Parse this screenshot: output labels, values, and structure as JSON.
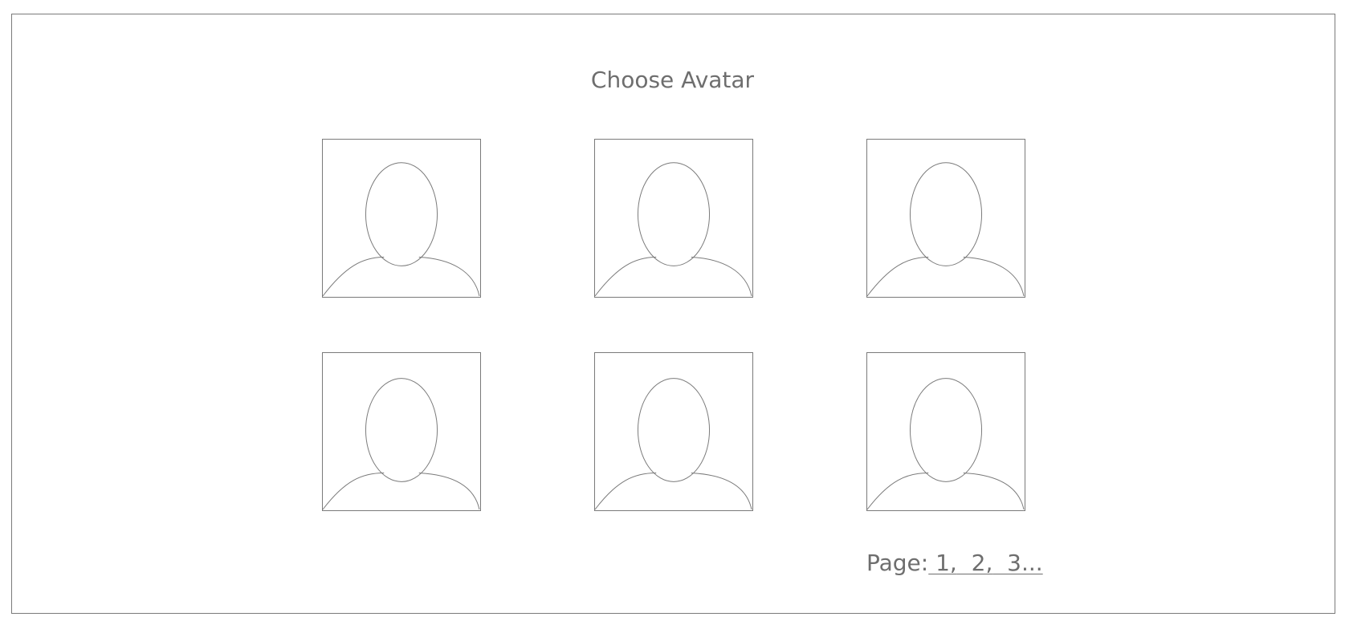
{
  "title": "Choose Avatar",
  "avatars": [
    {
      "icon": "person-placeholder-icon"
    },
    {
      "icon": "person-placeholder-icon"
    },
    {
      "icon": "person-placeholder-icon"
    },
    {
      "icon": "person-placeholder-icon"
    },
    {
      "icon": "person-placeholder-icon"
    },
    {
      "icon": "person-placeholder-icon"
    }
  ],
  "pagination": {
    "label": "Page:",
    "pages": [
      " 1,",
      "  2,",
      "  3..."
    ]
  },
  "colors": {
    "stroke": "#7a7a7a",
    "text": "#6e6e6e",
    "background": "#ffffff"
  }
}
